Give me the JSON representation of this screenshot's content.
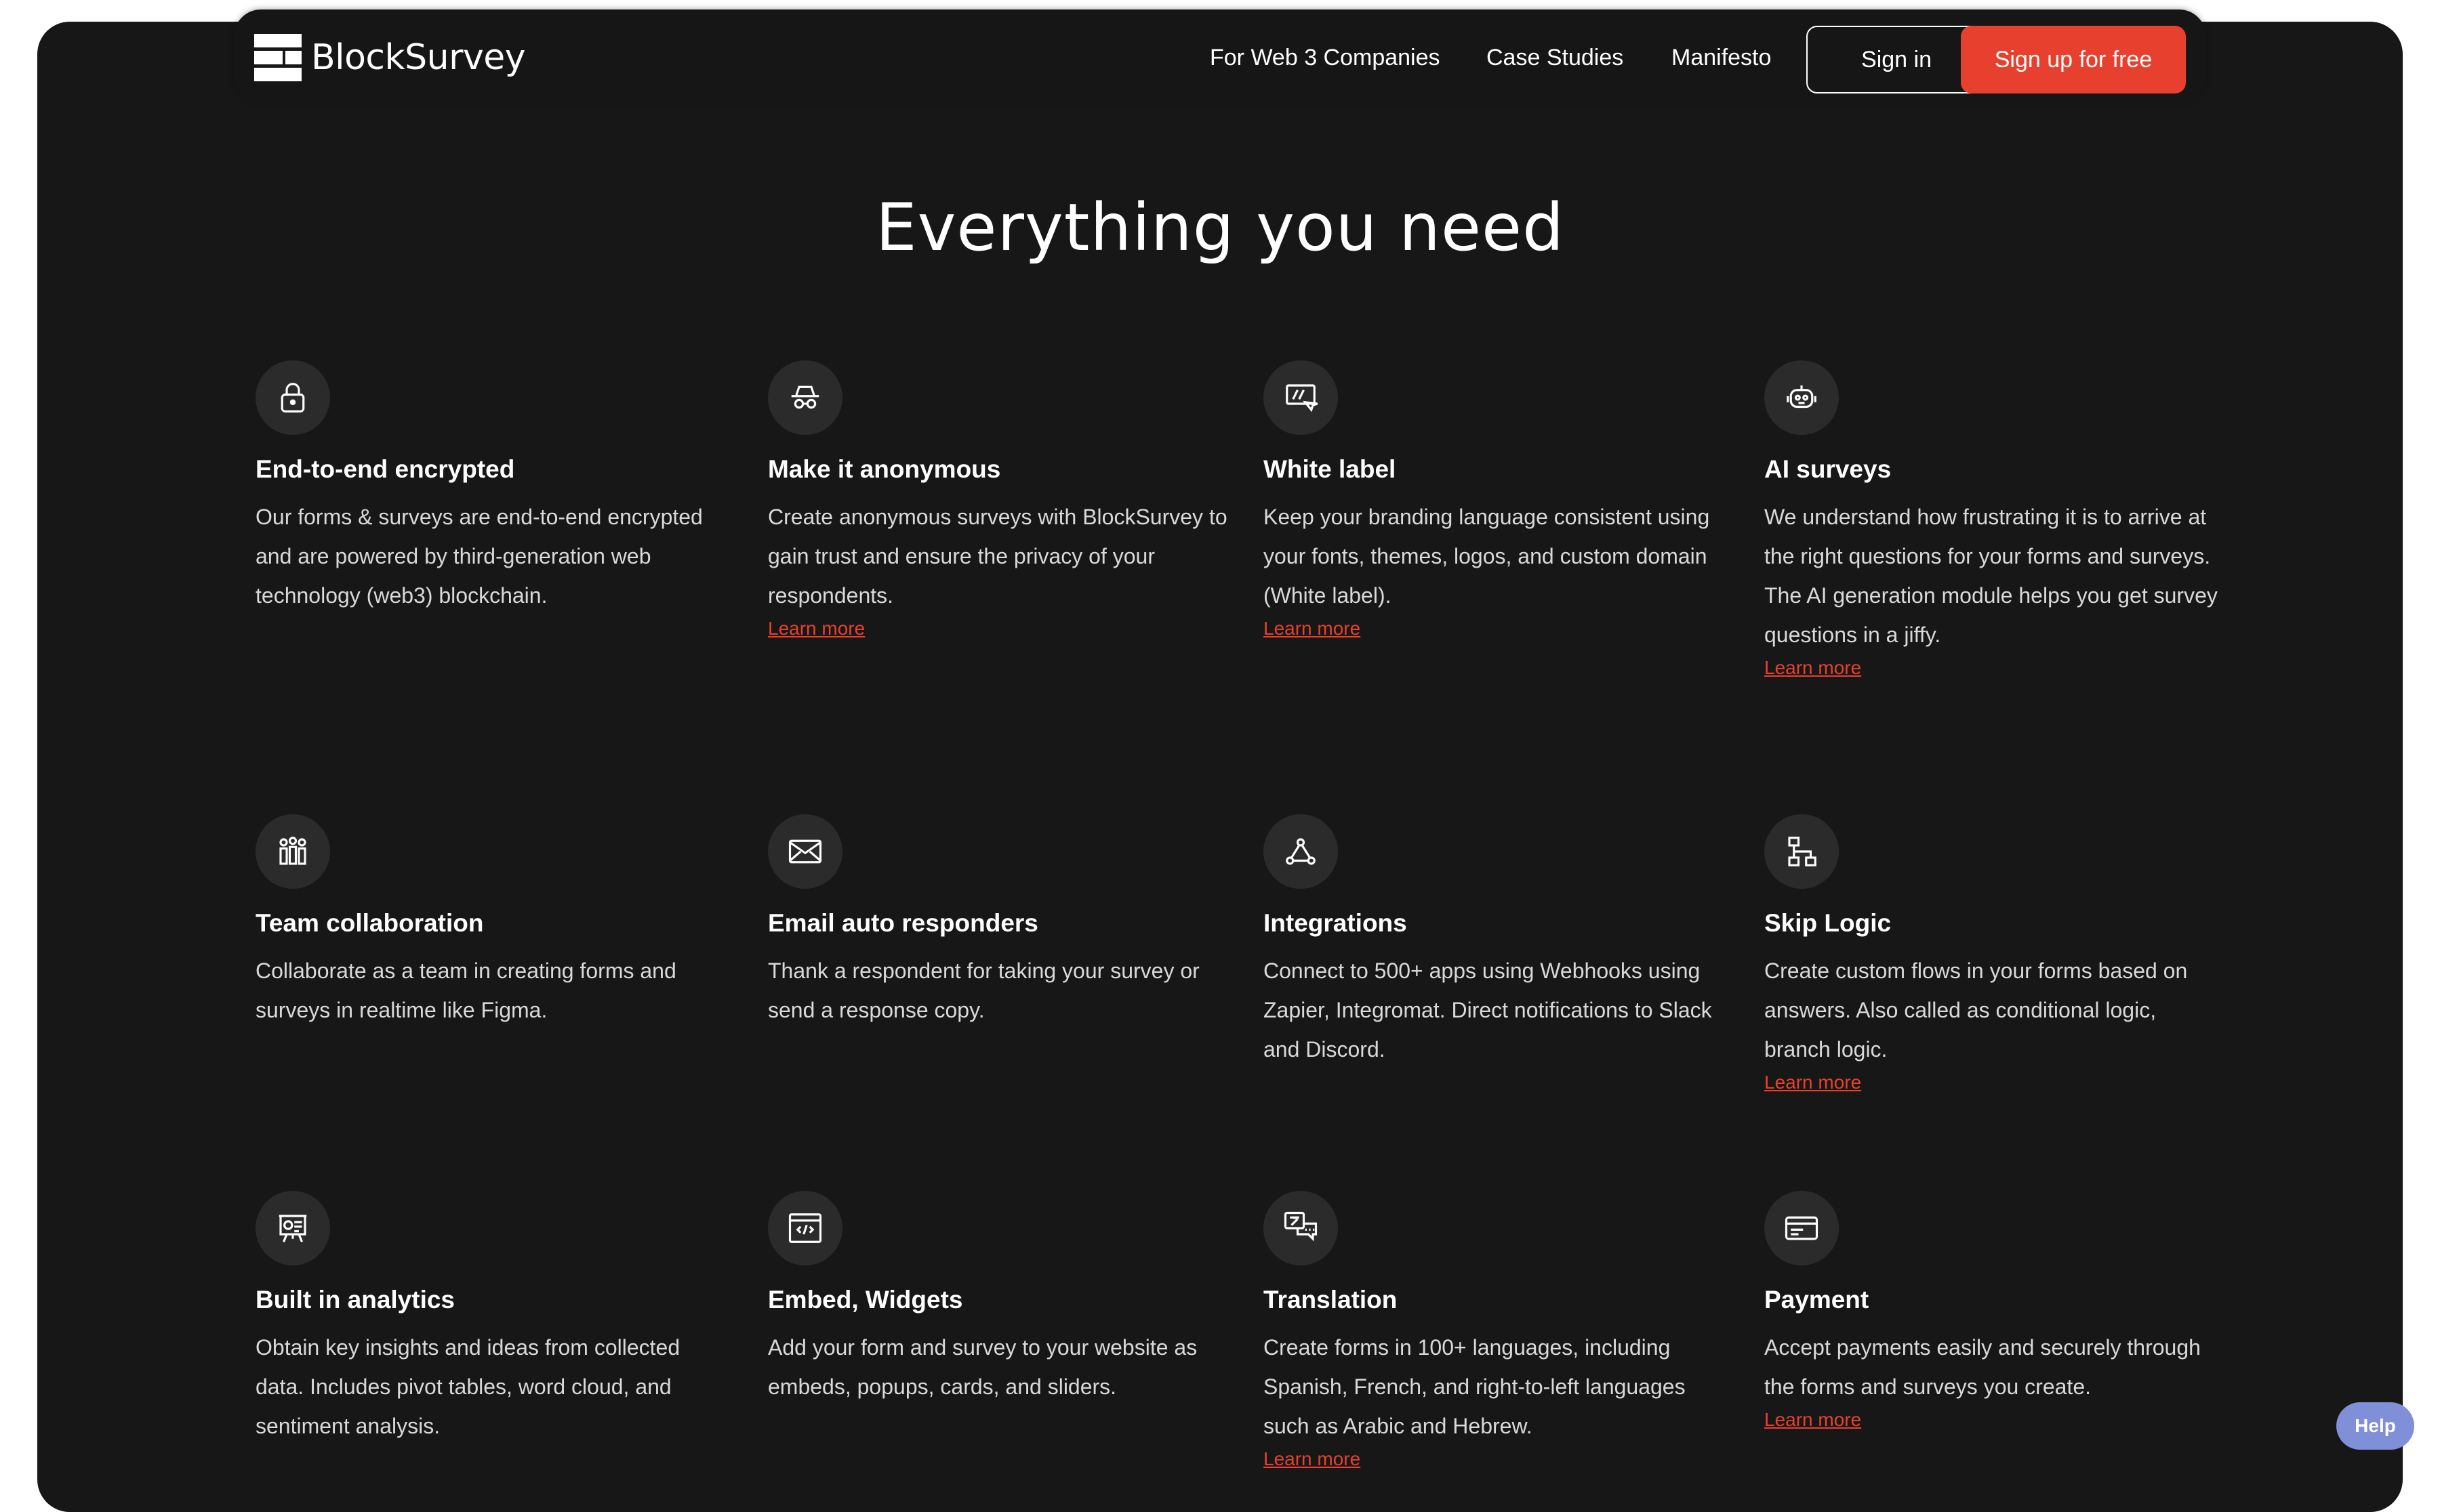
{
  "brand": {
    "name": "BlockSurvey"
  },
  "nav": {
    "links": [
      "For Web 3 Companies",
      "Case Studies",
      "Manifesto"
    ],
    "signin": "Sign in",
    "signup": "Sign up for free"
  },
  "hero": {
    "title": "Everything you need"
  },
  "features": [
    {
      "title": "End-to-end encrypted",
      "desc": "Our forms & surveys are end-to-end encrypted and are powered by third-generation web technology (web3) blockchain.",
      "link": "",
      "icon": "lock-icon"
    },
    {
      "title": "Make it anonymous",
      "desc": "Create anonymous surveys with BlockSurvey to gain trust and ensure the privacy of your respondents.",
      "link": "Learn more",
      "icon": "incognito-icon"
    },
    {
      "title": "White label",
      "desc": "Keep your branding language consistent using your fonts, themes, logos, and custom domain (White label).",
      "link": "Learn more",
      "icon": "white-label-icon"
    },
    {
      "title": "AI surveys",
      "desc": "We understand how frustrating it is to arrive at the right questions for your forms and surveys. The AI generation module helps you get survey questions in a jiffy.",
      "link": "Learn more",
      "icon": "robot-icon"
    },
    {
      "title": "Team collaboration",
      "desc": "Collaborate as a team in creating forms and surveys in realtime like Figma.",
      "link": "",
      "icon": "team-icon"
    },
    {
      "title": "Email auto responders",
      "desc": "Thank a respondent for taking your survey or send a response copy.",
      "link": "",
      "icon": "envelope-icon"
    },
    {
      "title": "Integrations",
      "desc": "Connect to 500+ apps using Webhooks using Zapier, Integromat. Direct notifications to Slack and Discord.",
      "link": "",
      "icon": "webhook-icon"
    },
    {
      "title": "Skip Logic",
      "desc": "Create custom flows in your forms based on answers. Also called as conditional logic, branch logic.",
      "link": "Learn more",
      "icon": "flow-icon"
    },
    {
      "title": "Built in analytics",
      "desc": "Obtain key insights and ideas from collected data. Includes pivot tables, word cloud, and sentiment analysis.",
      "link": "",
      "icon": "analytics-icon"
    },
    {
      "title": "Embed, Widgets",
      "desc": "Add your form and survey to your website as embeds, popups, cards, and sliders.",
      "link": "",
      "icon": "embed-code-icon"
    },
    {
      "title": "Translation",
      "desc": "Create forms in 100+ languages, including Spanish, French, and right-to-left languages such as Arabic and Hebrew.",
      "link": "Learn more",
      "icon": "translate-icon"
    },
    {
      "title": "Payment",
      "desc": "Accept payments easily and securely through the forms and surveys you create.",
      "link": "Learn more",
      "icon": "payment-card-icon"
    }
  ],
  "help": {
    "label": "Help"
  }
}
